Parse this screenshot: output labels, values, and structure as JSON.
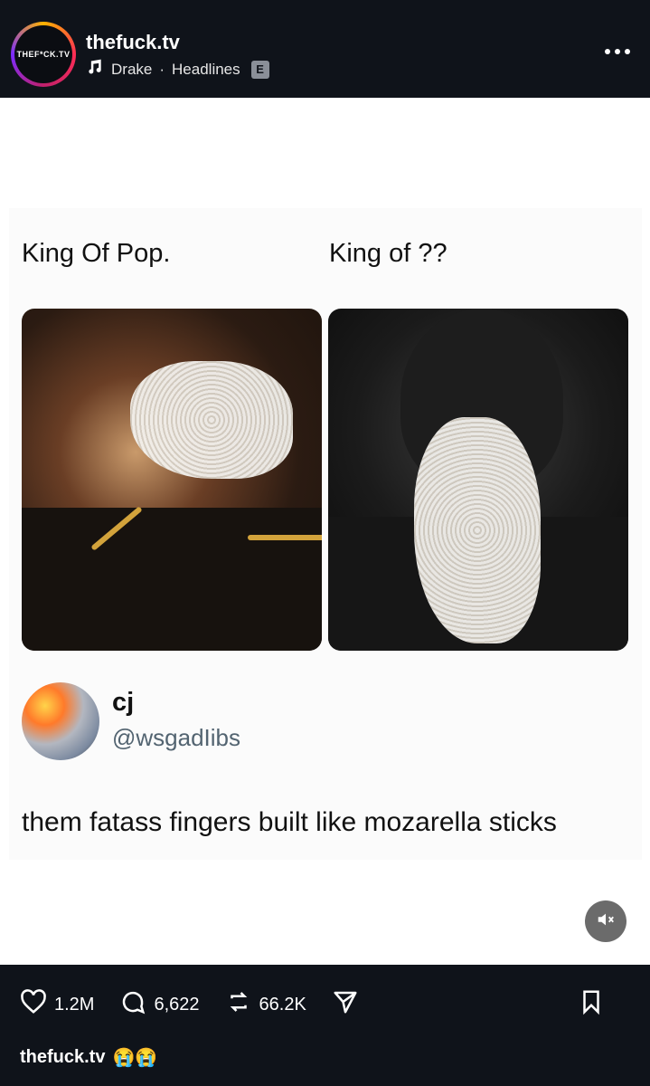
{
  "header": {
    "account_name": "thefuck.tv",
    "avatar_logo_text": "THEF*CK.TV",
    "music_artist": "Drake",
    "separator": "·",
    "song_title": "Headlines",
    "explicit_badge": "E"
  },
  "post": {
    "left_label": "King Of Pop.",
    "right_label": "King of ??",
    "tweet": {
      "name": "cj",
      "handle": "@wsgadIibs",
      "text": "them fatass fingers built like mozarella sticks"
    }
  },
  "footer": {
    "likes": "1.2M",
    "comments": "6,622",
    "reposts": "66.2K",
    "caption_account": "thefuck.tv",
    "caption_emojis": "😭😭"
  },
  "icons": [
    "music-note-icon",
    "more-icon",
    "mute-icon",
    "heart-icon",
    "comment-icon",
    "repost-icon",
    "share-icon",
    "bookmark-icon"
  ],
  "colors": {
    "header_bg": "#0f131a",
    "content_bg": "#ffffff",
    "handle_gray": "#536471"
  }
}
